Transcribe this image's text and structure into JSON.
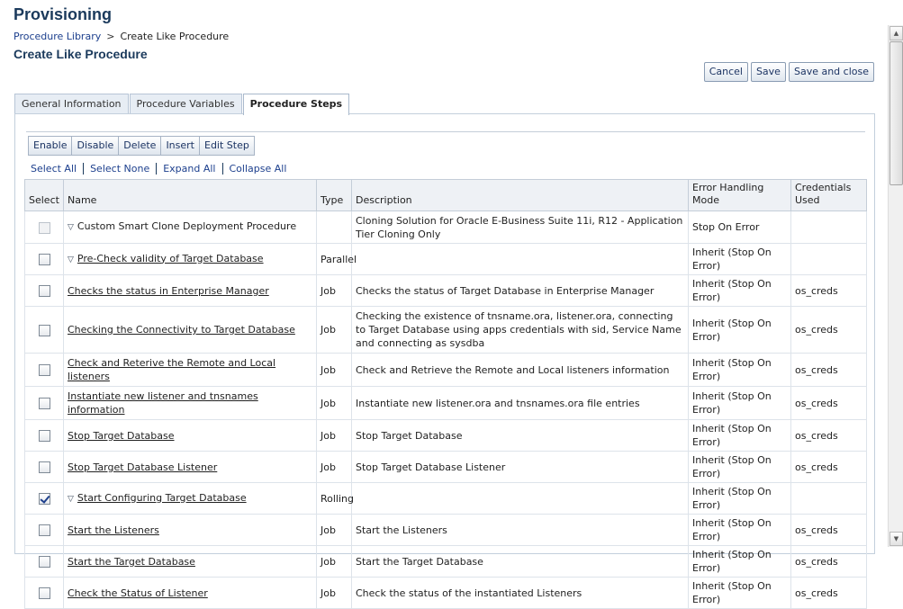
{
  "app": {
    "title": "Provisioning"
  },
  "breadcrumb": {
    "parent": "Procedure Library",
    "separator": ">",
    "current": "Create Like Procedure"
  },
  "page": {
    "title": "Create Like Procedure"
  },
  "actions": {
    "cancel": "Cancel",
    "save": "Save",
    "save_close": "Save and close"
  },
  "tabs": [
    {
      "label": "General Information"
    },
    {
      "label": "Procedure Variables"
    },
    {
      "label": "Procedure Steps"
    }
  ],
  "toolbar": {
    "enable": "Enable",
    "disable": "Disable",
    "delete": "Delete",
    "insert": "Insert",
    "edit_step": "Edit Step"
  },
  "selection": {
    "select_all": "Select All",
    "select_none": "Select None",
    "expand_all": "Expand All",
    "collapse_all": "Collapse All"
  },
  "table": {
    "headers": {
      "select": "Select",
      "name": "Name",
      "type": "Type",
      "description": "Description",
      "error_mode": "Error Handling Mode",
      "credentials": "Credentials Used"
    },
    "rows": [
      {
        "name": "Custom Smart Clone Deployment Procedure",
        "type": "",
        "description": "Cloning Solution for Oracle E-Business Suite 11i, R12 - Application Tier Cloning Only",
        "mode": "Stop On Error",
        "creds": ""
      },
      {
        "name": "Pre-Check validity of Target Database",
        "type": "Parallel",
        "description": "",
        "mode": "Inherit (Stop On Error)",
        "creds": ""
      },
      {
        "name": "Checks the status in Enterprise Manager",
        "type": "Job",
        "description": "Checks the status of Target Database in Enterprise Manager",
        "mode": "Inherit (Stop On Error)",
        "creds": "os_creds"
      },
      {
        "name": "Checking the Connectivity to Target Database",
        "type": "Job",
        "description": "Checking the existence of tnsname.ora, listener.ora, connecting to Target Database using apps credentials with sid, Service Name and connecting as sysdba",
        "mode": "Inherit (Stop On Error)",
        "creds": "os_creds"
      },
      {
        "name": "Check and Reterive the Remote and Local listeners",
        "type": "Job",
        "description": "Check and Retrieve the Remote and Local listeners information",
        "mode": "Inherit (Stop On Error)",
        "creds": "os_creds"
      },
      {
        "name": "Instantiate new listener and tnsnames information",
        "type": "Job",
        "description": "Instantiate new listener.ora and tnsnames.ora file entries",
        "mode": "Inherit (Stop On Error)",
        "creds": "os_creds"
      },
      {
        "name": "Stop Target Database",
        "type": "Job",
        "description": "Stop Target Database",
        "mode": "Inherit (Stop On Error)",
        "creds": "os_creds"
      },
      {
        "name": "Stop Target Database Listener",
        "type": "Job",
        "description": "Stop Target Database Listener",
        "mode": "Inherit (Stop On Error)",
        "creds": "os_creds"
      },
      {
        "name": "Start Configuring Target Database",
        "type": "Rolling",
        "description": "",
        "mode": "Inherit (Stop On Error)",
        "creds": ""
      },
      {
        "name": "Start the Listeners",
        "type": "Job",
        "description": "Start the Listeners",
        "mode": "Inherit (Stop On Error)",
        "creds": "os_creds"
      },
      {
        "name": "Start the Target Database",
        "type": "Job",
        "description": "Start the Target Database",
        "mode": "Inherit (Stop On Error)",
        "creds": "os_creds"
      },
      {
        "name": "Check the Status of Listener",
        "type": "Job",
        "description": "Check the status of the instantiated Listeners",
        "mode": "Inherit (Stop On Error)",
        "creds": "os_creds"
      }
    ]
  }
}
